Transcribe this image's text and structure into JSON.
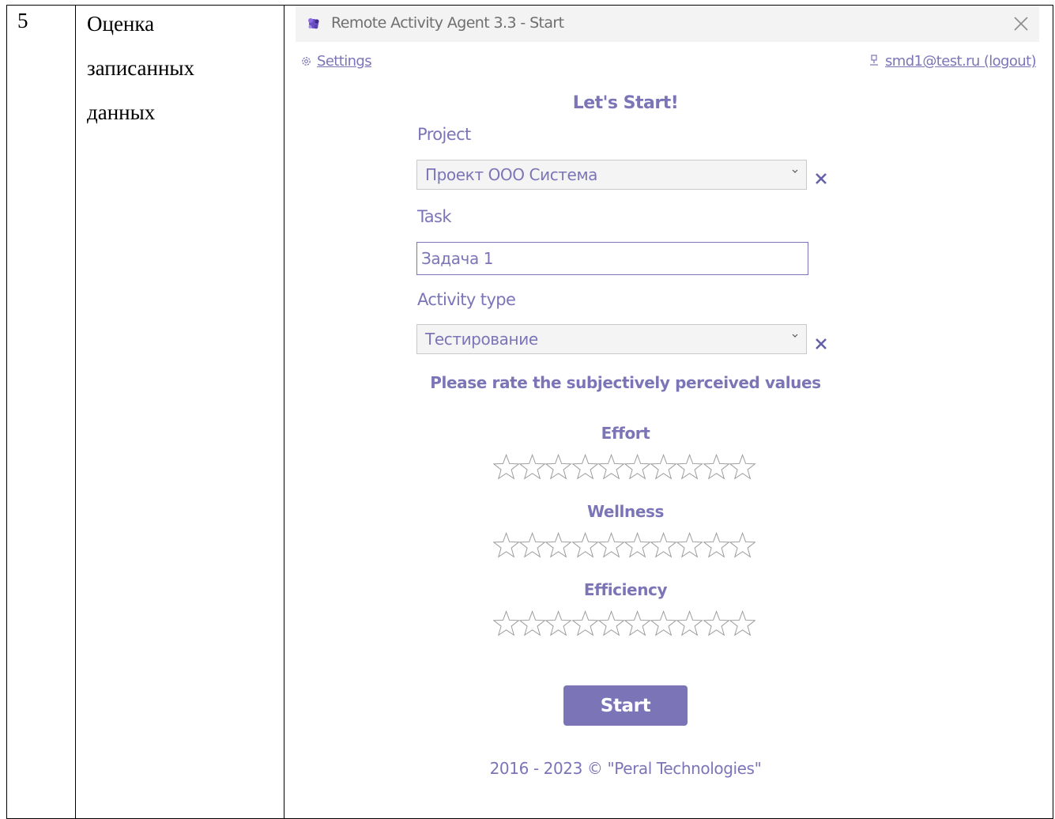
{
  "document": {
    "row_number": "5",
    "description_lines": [
      "Оценка",
      "записанных",
      "данных"
    ]
  },
  "window": {
    "title": "Remote Activity Agent 3.3 - Start",
    "icon": "app-logo-icon",
    "close_icon": "close-icon"
  },
  "toolbar": {
    "settings_label": "Settings",
    "user_label": "smd1@test.ru (logout)"
  },
  "form": {
    "heading": "Let's Start!",
    "project_label": "Project",
    "project_value": "Проект ООО Система",
    "task_label": "Task",
    "task_value": "Задача 1",
    "activity_label": "Activity type",
    "activity_value": "Тестирование",
    "rate_prompt": "Please rate the subjectively perceived values"
  },
  "ratings": [
    {
      "label": "Effort",
      "value": 0,
      "max": 10
    },
    {
      "label": "Wellness",
      "value": 0,
      "max": 10
    },
    {
      "label": "Efficiency",
      "value": 0,
      "max": 10
    }
  ],
  "start_label": "Start",
  "footer": "2016 - 2023 © \"Peral Technologies\"",
  "colors": {
    "accent": "#7b75b8",
    "titlebar": "#f3f3f3",
    "select_bg": "#f4f4f4"
  }
}
